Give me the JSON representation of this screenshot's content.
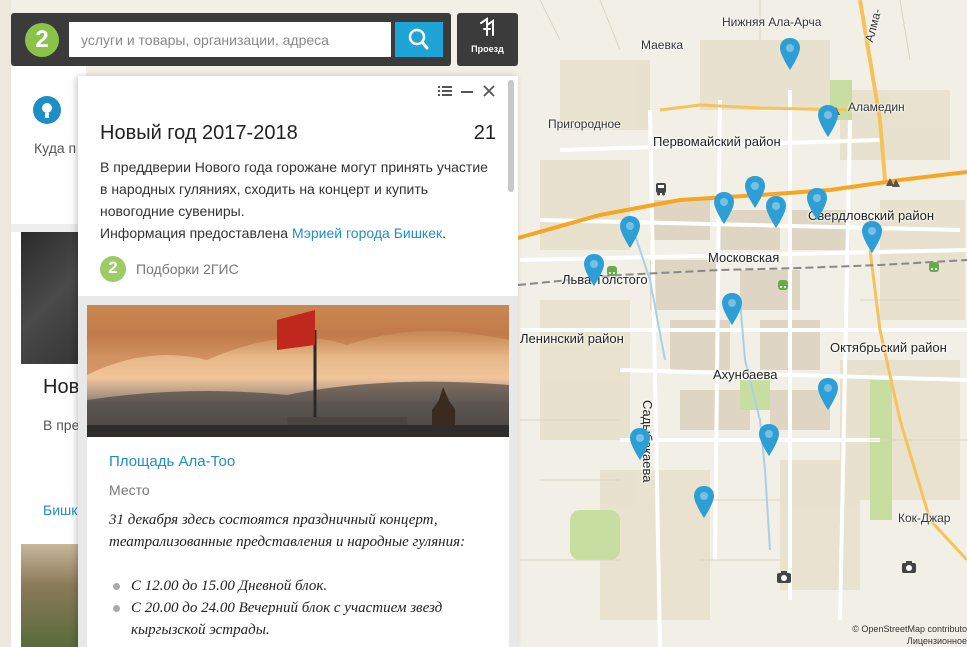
{
  "search": {
    "placeholder": "услуги и товары, организации, адреса",
    "route_label": "Проезд"
  },
  "back_panel": {
    "hint_text": "Куда п показа компа",
    "title": "Нов",
    "text": "В пре участ купит Инфо",
    "link": "Бишке"
  },
  "card": {
    "title": "Новый год 2017-2018",
    "count": "21",
    "description": "В преддверии Нового года горожане могут принять участие в народных гуляниях, сходить на концерт и купить новогодние сувениры.",
    "info_prefix": "Информация предоставлена",
    "info_link": "Мэрией города Бишкек",
    "info_suffix": ".",
    "source": "Подборки 2ГИС"
  },
  "item": {
    "title": "Площадь Ала-Тоо",
    "type": "Место",
    "description": "31 декабря здесь состоятся праздничный концерт, театрализованные представления и народные гуляния:",
    "schedule": [
      "С 12.00 до 15.00 Дневной блок.",
      "С 20.00 до 24.00 Вечерний блок с участием звезд кыргызской эстрады."
    ]
  },
  "map": {
    "labels": {
      "nizhnyaya": "Нижняя Ала-Арча",
      "maevka": "Маевка",
      "alamedin": "Аламедин",
      "prigorodnoe": "Пригородное",
      "pervomaysky": "Первомайский район",
      "sverdlovsky": "Свердловский район",
      "moskovskaya": "Московская",
      "lva_tolstogo": "Льва Толстого",
      "leninsky": "Ленинский район",
      "oktyabrsky": "Октябрьский район",
      "akhunbaeva": "Ахунбаева",
      "sadybakaeva": "Садыбакаева",
      "kok_jar": "Кок-Джар",
      "alma": "Алма-"
    },
    "attribution_1": "© OpenStreetMap contributo",
    "attribution_2": "Лицензионное"
  },
  "colors": {
    "accent": "#1ea5d6",
    "link": "#1e8fc6",
    "logo_green": "#8bc34a",
    "bar_dark": "#3b3b3b",
    "pin_blue": "#2e9fd4"
  }
}
